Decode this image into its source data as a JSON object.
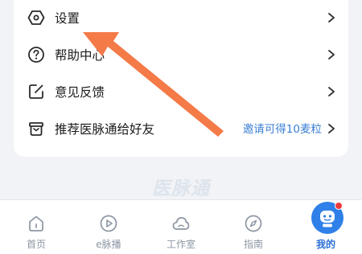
{
  "menu": {
    "items": [
      {
        "label": "设置",
        "icon": "settings-hexagon-icon"
      },
      {
        "label": "帮助中心",
        "icon": "help-circle-icon"
      },
      {
        "label": "意见反馈",
        "icon": "feedback-edit-icon"
      },
      {
        "label": "推荐医脉通给好友",
        "icon": "gift-icon",
        "extra": "邀请可得10麦粒"
      }
    ]
  },
  "watermark": "医脉通",
  "tabs": [
    {
      "label": "首页",
      "icon": "home-icon"
    },
    {
      "label": "e脉播",
      "icon": "play-icon"
    },
    {
      "label": "工作室",
      "icon": "cloud-icon"
    },
    {
      "label": "指南",
      "icon": "compass-icon"
    },
    {
      "label": "我的",
      "icon": "robot-avatar-icon",
      "active": true
    }
  ],
  "colors": {
    "accent": "#2b6fd6",
    "annotation_arrow": "#f47a48",
    "link": "#3b7fd4",
    "badge": "#ef3b3b"
  }
}
